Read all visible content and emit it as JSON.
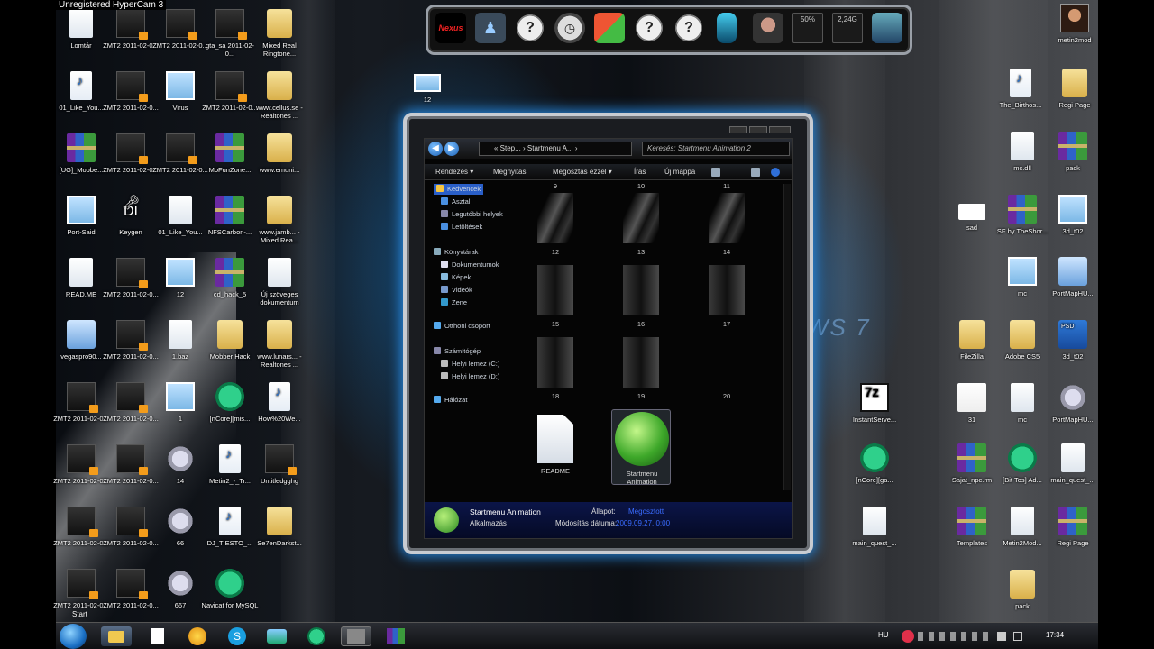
{
  "recorder_watermark": "Unregistered HyperCam 3",
  "wallpaper_text": "WS 7",
  "desktop_icons_left": [
    {
      "label": "Lomtár",
      "type": "doc"
    },
    {
      "label": "ZMT2 2011-02-0...",
      "type": "film"
    },
    {
      "label": "ZMT2 2011-02-0...",
      "type": "film"
    },
    {
      "label": "gta_sa 2011-02-0...",
      "type": "film"
    },
    {
      "label": "Mixed Real Ringtone...",
      "type": "folder"
    },
    {
      "label": "01_Like_You...",
      "type": "audio"
    },
    {
      "label": "ZMT2 2011-02-0...",
      "type": "film"
    },
    {
      "label": "Virus",
      "type": "img"
    },
    {
      "label": "ZMT2 2011-02-0...",
      "type": "film"
    },
    {
      "label": "www.cellus.se - Realtones ...",
      "type": "folder"
    },
    {
      "label": "[UG]_Mobbe...",
      "type": "rar"
    },
    {
      "label": "ZMT2 2011-02-0...",
      "type": "film"
    },
    {
      "label": "ZMT2 2011-02-0...",
      "type": "film"
    },
    {
      "label": "MoFunZone...",
      "type": "rar"
    },
    {
      "label": "www.emuni...",
      "type": "folder"
    },
    {
      "label": "Port-Said",
      "type": "img"
    },
    {
      "label": "Keygen",
      "type": "key"
    },
    {
      "label": "01_Like_You...",
      "type": "doc"
    },
    {
      "label": "NFSCarbon-...",
      "type": "rar"
    },
    {
      "label": "www.jamb... - Mixed Rea...",
      "type": "folder"
    },
    {
      "label": "READ.ME",
      "type": "doc"
    },
    {
      "label": "ZMT2 2011-02-0...",
      "type": "film"
    },
    {
      "label": "12",
      "type": "img"
    },
    {
      "label": "cd_hack_5",
      "type": "rar"
    },
    {
      "label": "Új szöveges dokumentum",
      "type": "doc"
    },
    {
      "label": "vegaspro90...",
      "type": "net"
    },
    {
      "label": "ZMT2 2011-02-0...",
      "type": "film"
    },
    {
      "label": "1.baz",
      "type": "doc"
    },
    {
      "label": "Mobber Hack",
      "type": "folder"
    },
    {
      "label": "www.lunars... - Realtones ...",
      "type": "folder"
    },
    {
      "label": "ZMT2 2011-02-0...",
      "type": "film"
    },
    {
      "label": "ZMT2 2011-02-0...",
      "type": "film"
    },
    {
      "label": "1",
      "type": "img"
    },
    {
      "label": "[nCore][mis...",
      "type": "torrent"
    },
    {
      "label": "How%20We...",
      "type": "audio"
    },
    {
      "label": "ZMT2 2011-02-0...",
      "type": "film"
    },
    {
      "label": "ZMT2 2011-02-0...",
      "type": "film"
    },
    {
      "label": "14",
      "type": "gear"
    },
    {
      "label": "Metin2_-_Tr...",
      "type": "audio"
    },
    {
      "label": "Untitledgghg",
      "type": "film"
    },
    {
      "label": "ZMT2 2011-02-0...",
      "type": "film"
    },
    {
      "label": "ZMT2 2011-02-0...",
      "type": "film"
    },
    {
      "label": "66",
      "type": "gear"
    },
    {
      "label": "DJ_TIESTO_...",
      "type": "audio"
    },
    {
      "label": "Se7enDarkst...",
      "type": "folder"
    },
    {
      "label": "ZMT2 2011-02-0...",
      "type": "film"
    },
    {
      "label": "ZMT2 2011-02-0...",
      "type": "film"
    },
    {
      "label": "667",
      "type": "gear"
    },
    {
      "label": "Navicat for MySQL",
      "type": "torrent"
    }
  ],
  "desktop_icons_right": [
    {
      "label": "metin2mod",
      "type": "avatar"
    },
    {
      "label": "The_Birthos...",
      "type": "audio"
    },
    {
      "label": "Regi Page",
      "type": "folder"
    },
    {
      "label": "mc.dll",
      "type": "doc"
    },
    {
      "label": "pack",
      "type": "rar"
    },
    {
      "label": "sad",
      "type": "white"
    },
    {
      "label": "SF by TheShor...",
      "type": "rar"
    },
    {
      "label": "3d_t02",
      "type": "img"
    },
    {
      "label": "mc",
      "type": "img"
    },
    {
      "label": "PortMapHU...",
      "type": "net"
    },
    {
      "label": "FileZilla",
      "type": "folder"
    },
    {
      "label": "Adobe CS5",
      "type": "folder"
    },
    {
      "label": "3d_t02",
      "type": "ps"
    },
    {
      "label": "InstantServe...",
      "type": "7z"
    },
    {
      "label": "31",
      "type": "mail"
    },
    {
      "label": "mc",
      "type": "doc"
    },
    {
      "label": "PortMapHU...",
      "type": "gear"
    },
    {
      "label": "[nCore][ga...",
      "type": "torrent"
    },
    {
      "label": "Sajat_npc.rm",
      "type": "rar"
    },
    {
      "label": "[Bit Tos] Ad...",
      "type": "torrent"
    },
    {
      "label": "main_quest_...",
      "type": "doc"
    },
    {
      "label": "main_quest_...",
      "type": "doc"
    },
    {
      "label": "Templates",
      "type": "rar"
    },
    {
      "label": "Metin2Mod...",
      "type": "doc"
    },
    {
      "label": "Regi Page",
      "type": "rar"
    },
    {
      "label": "pack",
      "type": "folder"
    }
  ],
  "floating_icon_label": "12",
  "dock": {
    "logo": "Nexus",
    "cpu_meter": "50%",
    "mem_meter": "2,24G"
  },
  "explorer": {
    "breadcrumb": "« Step... › Startmenu A... ›",
    "search_placeholder": "Keresés: Startmenu Animation 2",
    "commands": [
      "Rendezés ▾",
      "Megnyitás",
      "Megosztás ezzel ▾",
      "Írás",
      "Új mappa"
    ],
    "nav": [
      {
        "label": "Kedvencek",
        "indent": 0,
        "selected": true
      },
      {
        "label": "Asztal",
        "indent": 1
      },
      {
        "label": "Legutóbbi helyek",
        "indent": 1
      },
      {
        "label": "Letöltések",
        "indent": 1
      },
      {
        "label": "Könyvtárak",
        "indent": 0
      },
      {
        "label": "Dokumentumok",
        "indent": 1
      },
      {
        "label": "Képek",
        "indent": 1
      },
      {
        "label": "Videók",
        "indent": 1
      },
      {
        "label": "Zene",
        "indent": 1
      },
      {
        "label": "Otthoni csoport",
        "indent": 0
      },
      {
        "label": "Számítógép",
        "indent": 0
      },
      {
        "label": "Helyi lemez (C:)",
        "indent": 1
      },
      {
        "label": "Helyi lemez (D:)",
        "indent": 1
      },
      {
        "label": "Hálózat",
        "indent": 0
      }
    ],
    "thumb_labels_top": [
      "9",
      "10",
      "11"
    ],
    "thumbs": [
      "12",
      "13",
      "14",
      "15",
      "16",
      "17",
      "18",
      "19",
      "20"
    ],
    "files": [
      {
        "label": "README",
        "type": "doc"
      },
      {
        "label": "Startmenu Animation",
        "type": "orb"
      }
    ],
    "details": {
      "name": "Startmenu Animation",
      "kind": "Alkalmazás",
      "state_label": "Állapot:",
      "state_value": "Megosztott",
      "modified_label": "Módosítás dátuma:",
      "modified_value": "2009.09.27. 0:00"
    }
  },
  "taskbar": {
    "language": "HU",
    "clock": "17:34",
    "start_tooltip": "Start"
  }
}
